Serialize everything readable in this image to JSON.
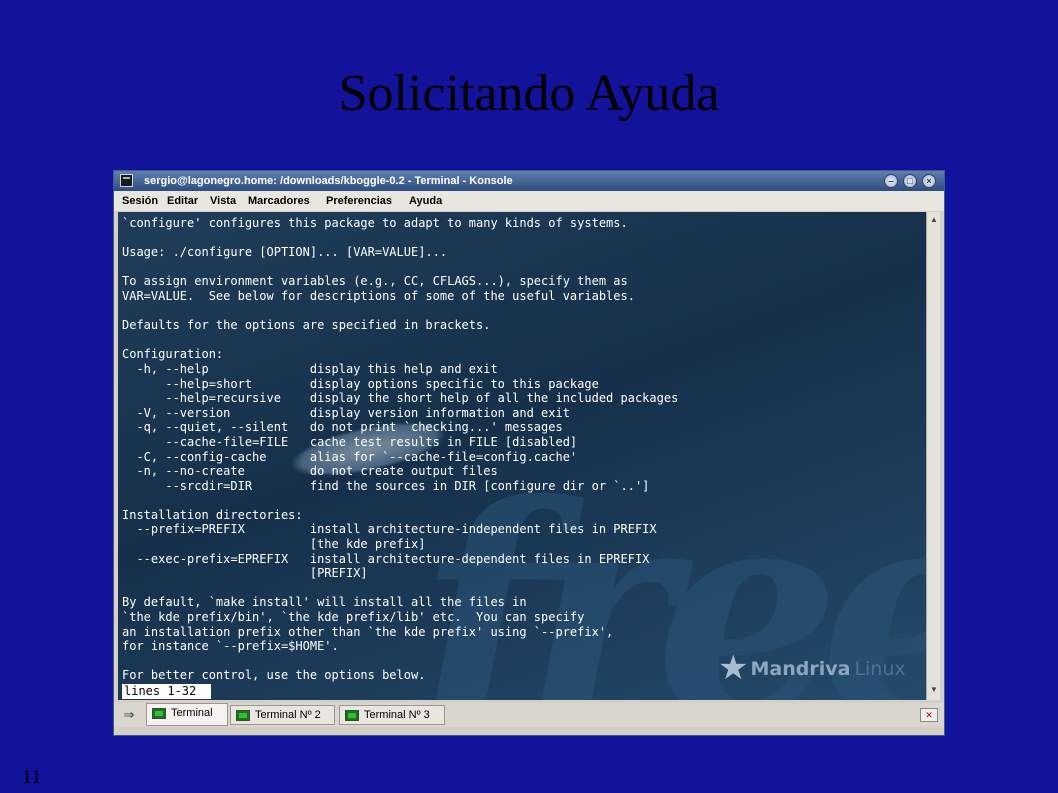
{
  "slide": {
    "title": "Solicitando Ayuda",
    "number": "11"
  },
  "window": {
    "title": "sergio@lagonegro.home: /downloads/kboggle-0.2 - Terminal - Konsole",
    "controls": {
      "minimize": "–",
      "maximize": "□",
      "close": "×"
    },
    "menu": [
      "Sesión",
      "Editar",
      "Vista",
      "Marcadores",
      "Preferencias",
      "Ayuda"
    ]
  },
  "terminal": {
    "lines": [
      "`configure' configures this package to adapt to many kinds of systems.",
      "",
      "Usage: ./configure [OPTION]... [VAR=VALUE]...",
      "",
      "To assign environment variables (e.g., CC, CFLAGS...), specify them as",
      "VAR=VALUE.  See below for descriptions of some of the useful variables.",
      "",
      "Defaults for the options are specified in brackets.",
      "",
      "Configuration:",
      "  -h, --help              display this help and exit",
      "      --help=short        display options specific to this package",
      "      --help=recursive    display the short help of all the included packages",
      "  -V, --version           display version information and exit",
      "  -q, --quiet, --silent   do not print `checking...' messages",
      "      --cache-file=FILE   cache test results in FILE [disabled]",
      "  -C, --config-cache      alias for `--cache-file=config.cache'",
      "  -n, --no-create         do not create output files",
      "      --srcdir=DIR        find the sources in DIR [configure dir or `..']",
      "",
      "Installation directories:",
      "  --prefix=PREFIX         install architecture-independent files in PREFIX",
      "                          [the kde prefix]",
      "  --exec-prefix=EPREFIX   install architecture-dependent files in EPREFIX",
      "                          [PREFIX]",
      "",
      "By default, `make install' will install all the files in",
      "`the kde prefix/bin', `the kde prefix/lib' etc.  You can specify",
      "an installation prefix other than `the kde prefix' using `--prefix',",
      "for instance `--prefix=$HOME'.",
      "",
      "For better control, use the options below."
    ],
    "status": "lines 1-32",
    "watermark": {
      "big_text": "free",
      "brand": "Mandriva",
      "brand_suffix": "Linux"
    }
  },
  "tabs": [
    {
      "label": "Terminal",
      "active": true
    },
    {
      "label": "Terminal Nº 2",
      "active": false
    },
    {
      "label": "Terminal Nº 3",
      "active": false
    }
  ],
  "icons": {
    "new_tab": "new-tab-icon",
    "close_tab": "close-tab-icon",
    "tab": "terminal-icon"
  }
}
